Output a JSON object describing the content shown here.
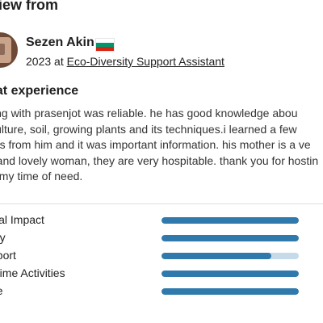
{
  "heading": "view from",
  "reviewer": {
    "name": "Sezen Akin",
    "flag_icon": "bulgaria-flag-icon",
    "year": "2023",
    "at": "at",
    "organization": "Eco-Diversity Support Assistant"
  },
  "review": {
    "title": "eat experience",
    "lines": [
      "ying with prasenjot was reliable. he has good knowledge abou",
      "iculture, soil, growing plants and its techniques.i learned a few",
      "ngs from him and it was important information. his mother is a ve",
      "d and lovely woman, they are very hospitable. thank you for hostin",
      " in my time of need."
    ]
  },
  "ratings": [
    {
      "label": "cial Impact",
      "value": 1.0
    },
    {
      "label": "ety",
      "value": 1.0
    },
    {
      "label": "pport",
      "value": 0.8
    },
    {
      "label": "etime Activities",
      "value": 1.0
    },
    {
      "label": "ue",
      "value": 1.0
    }
  ],
  "colors": {
    "bar_fill": "#2f79ac",
    "bar_track": "#c6dbea"
  }
}
